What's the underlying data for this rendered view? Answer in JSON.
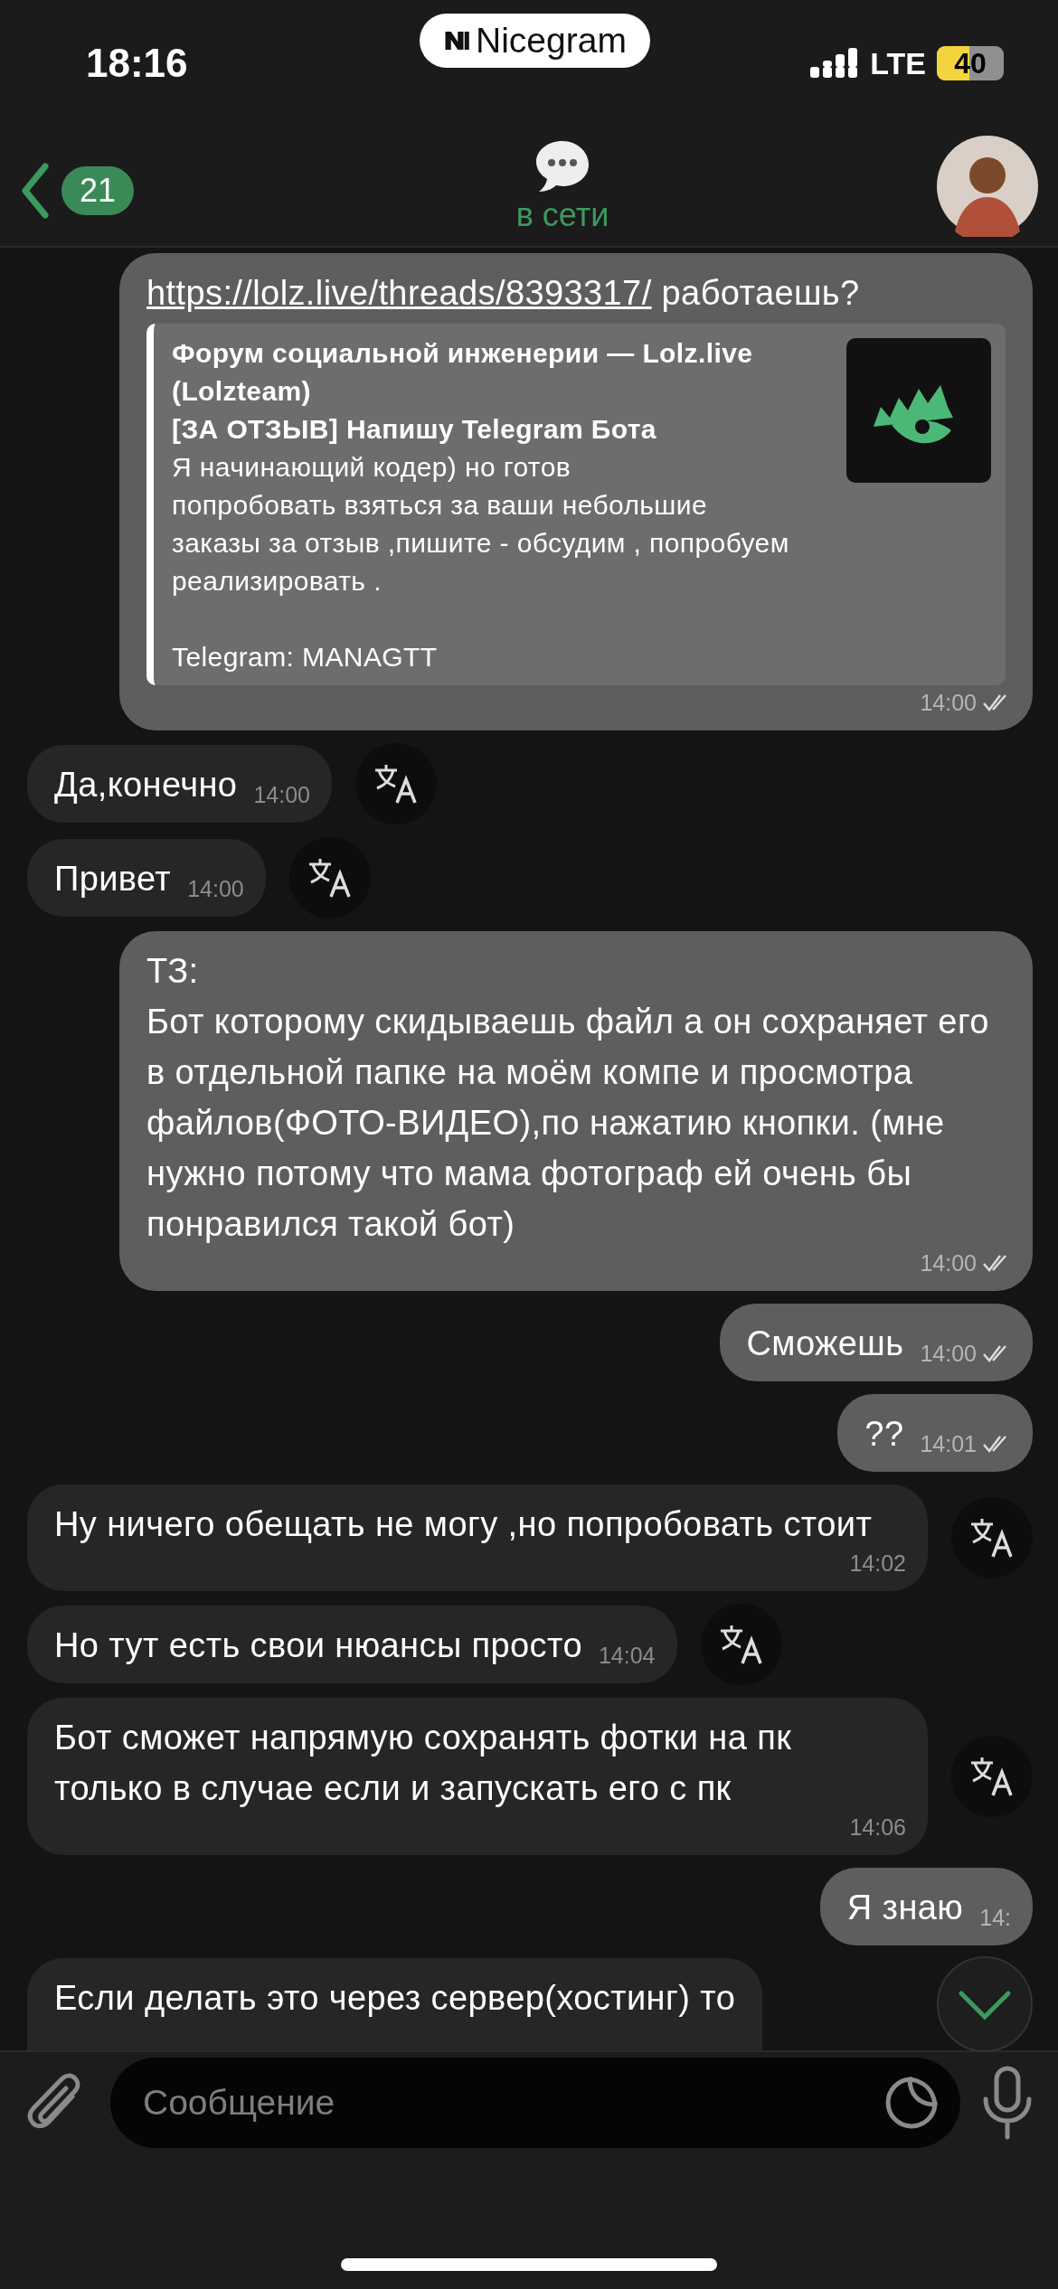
{
  "status_bar": {
    "time": "18:16",
    "app_badge": "Nicegram",
    "network": "LTE",
    "battery": "40"
  },
  "header": {
    "back_count": "21",
    "status": "в сети"
  },
  "messages": [
    {
      "kind": "outgoing",
      "link": "https://lolz.live/threads/8393317/",
      "text": "работаешь?",
      "time": "14:00",
      "read": true,
      "link_preview": {
        "site": "Форум социальной инженерии —  Lolz.live (Lolzteam)",
        "title": "[ЗА ОТЗЫВ] Напишу Telegram Бота",
        "description": "Я начинающий кодер) но готов\nпопробовать взяться за ваши небольшие\nзаказы за отзыв ,пишите - обсудим , попробуем\nреализировать .\n\nTelegram: MANAGTT"
      }
    },
    {
      "kind": "incoming",
      "text": "Да,конечно",
      "time": "14:00",
      "translate": true
    },
    {
      "kind": "incoming",
      "text": "Привет",
      "time": "14:00",
      "translate": true
    },
    {
      "kind": "outgoing",
      "text": "ТЗ:\nБот которому скидываешь файл а он сохраняет его в отдельной папке на моём компе и просмотра файлов(ФОТО-ВИДЕО),по нажатию кнопки. (мне нужно потому что мама фотограф ей очень бы понравился такой бот)",
      "time": "14:00",
      "read": true
    },
    {
      "kind": "outgoing",
      "text": "Сможешь",
      "time": "14:00",
      "read": true
    },
    {
      "kind": "outgoing",
      "text": "??",
      "time": "14:01",
      "read": true
    },
    {
      "kind": "incoming",
      "text": "Ну ничего обещать не могу ,но попробовать стоит",
      "time": "14:02",
      "translate": true
    },
    {
      "kind": "incoming",
      "text": "Но тут есть свои нюансы просто",
      "time": "14:04",
      "translate": true
    },
    {
      "kind": "incoming",
      "text": "Бот сможет напрямую сохранять фотки на пк только в случае если и запускать его с пк",
      "time": "14:06",
      "translate": true
    },
    {
      "kind": "outgoing",
      "text": "Я знаю",
      "time": "14:"
    },
    {
      "kind": "incoming",
      "text": "Если делать это через сервер(хостинг) то"
    }
  ],
  "composer": {
    "placeholder": "Сообщение"
  }
}
